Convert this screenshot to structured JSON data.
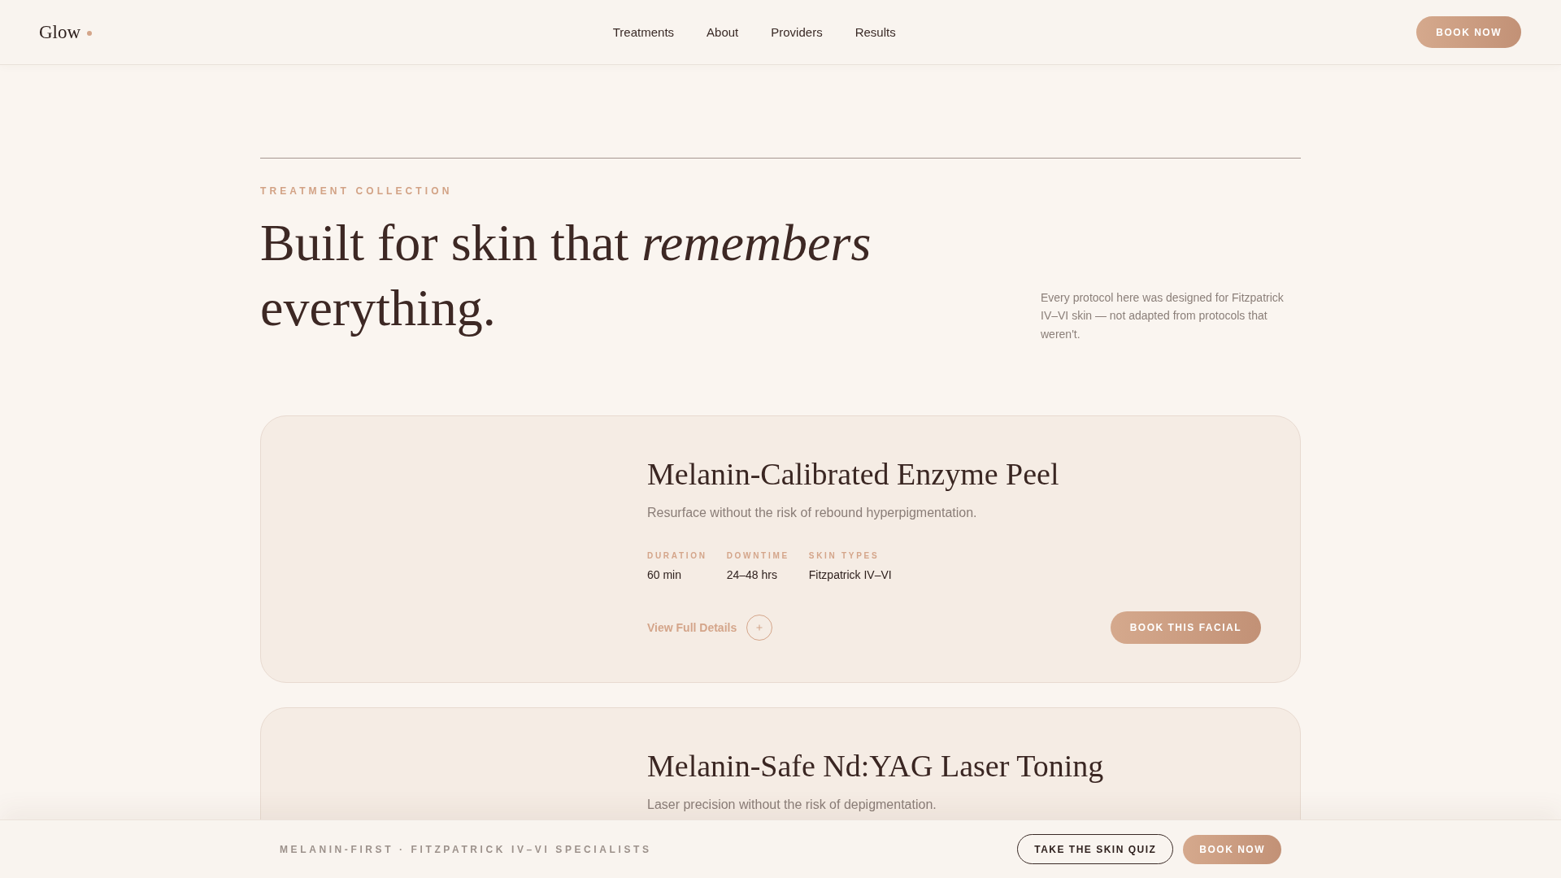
{
  "header": {
    "logo": "Glow",
    "nav": [
      "Treatments",
      "About",
      "Providers",
      "Results"
    ],
    "book_button": "BOOK NOW"
  },
  "intro": {
    "eyebrow": "TREATMENT COLLECTION",
    "headline": "Built for skin that *remembers* everything.",
    "description": "Every protocol here was designed for Fitzpatrick IV–VI skin — not adapted from protocols that weren't."
  },
  "treatments": [
    {
      "title": "Melanin-Calibrated Enzyme Peel",
      "subtitle": "Resurface without the risk of rebound hyperpigmentation.",
      "meta": [
        {
          "label": "DURATION",
          "value": "60 min"
        },
        {
          "label": "DOWNTIME",
          "value": "24–48 hrs"
        },
        {
          "label": "SKIN TYPES",
          "value": "Fitzpatrick IV–VI"
        }
      ],
      "details_link": "View Full Details",
      "book_button": "BOOK THIS FACIAL"
    },
    {
      "title": "Melanin-Safe Nd:YAG Laser Toning",
      "subtitle": "Laser precision without the risk of depigmentation."
    }
  ],
  "bottom_bar": {
    "tagline": "MELANIN-FIRST · FITZPATRICK IV–VI SPECIALISTS",
    "buttons": [
      {
        "label": "TAKE THE SKIN QUIZ",
        "kind": "outline"
      },
      {
        "label": "BOOK NOW",
        "kind": "filled"
      }
    ]
  }
}
